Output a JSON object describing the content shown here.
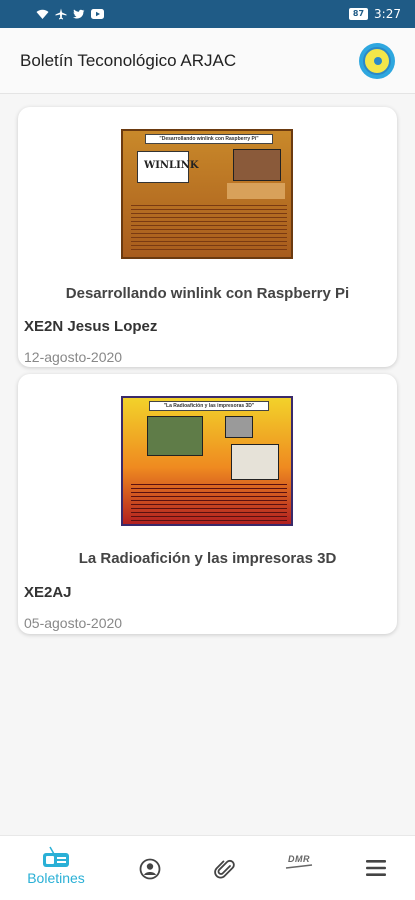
{
  "status_bar": {
    "time": "3:27",
    "battery": "87",
    "icons": [
      "wifi-icon",
      "airplane-icon",
      "twitter-icon",
      "youtube-icon"
    ]
  },
  "app_bar": {
    "title": "Boletín Teconológico ARJAC",
    "logo_icon": "arjac-logo-icon"
  },
  "bulletins": [
    {
      "image_banner": "\"Desarrollando winlink con Raspberry Pi\"",
      "image_logo": "WINLINK",
      "title": "Desarrollando winlink con Raspberry Pi",
      "author": "XE2N Jesus Lopez",
      "date": "12-agosto-2020"
    },
    {
      "image_banner": "\"La Radioafición y las impresoras 3D\"",
      "title": "La Radioafición y las impresoras 3D",
      "author": "XE2AJ",
      "date": "05-agosto-2020"
    }
  ],
  "bottom_nav": {
    "items": [
      {
        "label": "Boletines",
        "icon": "radio-icon",
        "active": true
      },
      {
        "label": "",
        "icon": "profile-icon",
        "active": false
      },
      {
        "label": "",
        "icon": "paperclip-icon",
        "active": false
      },
      {
        "label": "DMR",
        "icon": "dmr-icon",
        "active": false
      },
      {
        "label": "",
        "icon": "menu-icon",
        "active": false
      }
    ]
  },
  "colors": {
    "status_bar": "#1f5b86",
    "accent": "#2ab0d6"
  }
}
